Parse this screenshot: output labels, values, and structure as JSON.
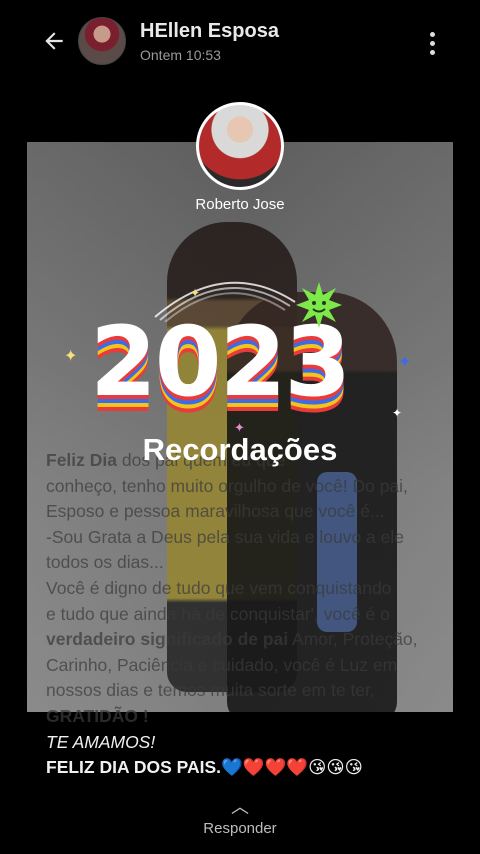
{
  "header": {
    "contact_name": "HEllen Esposa",
    "time": "Ontem 10:53"
  },
  "story": {
    "author_name": "Roberto Jose",
    "year": "2023",
    "title": "Recordações",
    "caption": {
      "l1_bold": "Feliz Dia",
      "l1_rest": " dos            pai     quem eu   que",
      "l2": "conheço, tenho muito orgulho de você! Do pai,",
      "l3": "Esposo e pessoa maravilhosa que você é...",
      "l4": " -Sou Grata a Deus pela sua vida e louvo a ele",
      "l5": "todos os dias...",
      "l6": "Você é digno de tudo que vem conquistando",
      "l7": "e tudo que ainda há de conquistar', você é o",
      "l8_bold": "verdadeiro significado de pai",
      "l8_rest": " Amor, Proteção,",
      "l9": "Carinho, Paciência e cuidado, você é Luz em",
      "l10": "nossos dias e temos muita sorte em te ter,",
      "l11": "GRATIDÃO !",
      "l12": " TE AMAMOS!",
      "l13": "FELIZ DIA DOS PAIS.💙❤️❤️❤️😘😘😘"
    }
  },
  "footer": {
    "reply_label": "Responder"
  }
}
